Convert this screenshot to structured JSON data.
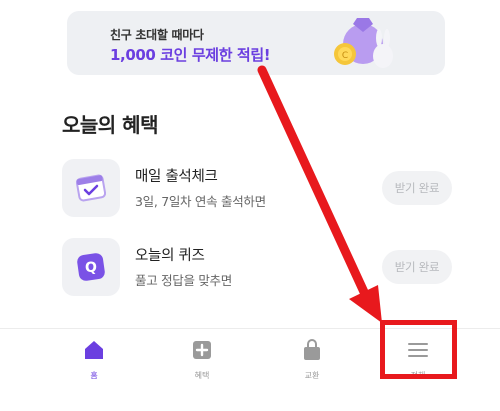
{
  "banner": {
    "subtitle": "친구 초대할 때마다",
    "title": "1,000 코인 무제한 적립!"
  },
  "section": {
    "title": "오늘의 혜택"
  },
  "benefits": [
    {
      "name": "매일 출석체크",
      "desc": "3일, 7일차 연속 출석하면",
      "status": "받기 완료",
      "icon": "calendar-check-icon"
    },
    {
      "name": "오늘의 퀴즈",
      "desc": "풀고 정답을 맞추면",
      "status": "받기 완료",
      "icon": "quiz-q-icon"
    }
  ],
  "tabbar": {
    "items": [
      {
        "label": "홈",
        "icon": "home-icon",
        "active": true
      },
      {
        "label": "혜택",
        "icon": "plus-square-icon",
        "active": false
      },
      {
        "label": "교환",
        "icon": "shopping-bag-icon",
        "active": false
      },
      {
        "label": "전체",
        "icon": "hamburger-menu-icon",
        "active": false
      }
    ]
  },
  "colors": {
    "accent": "#6b3fe0",
    "annotation_red": "#e8191d",
    "card_bg": "#eef0f3"
  }
}
